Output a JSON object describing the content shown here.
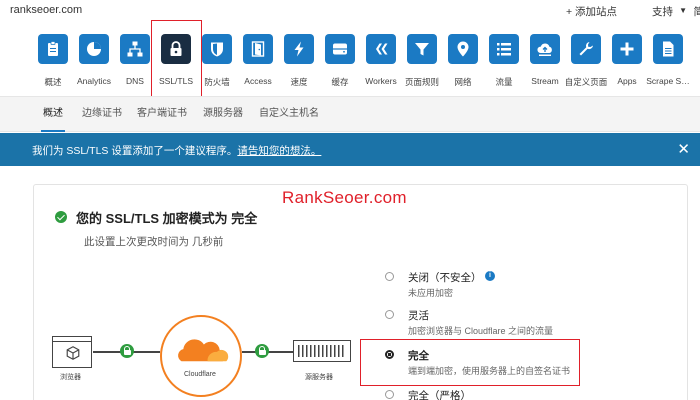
{
  "topbar": {
    "domain": "rankseoer.com",
    "add_site": "+ 添加站点",
    "support": "支持",
    "lang": "简"
  },
  "nav": {
    "items": [
      {
        "label": "概述",
        "icon": "clipboard-icon"
      },
      {
        "label": "Analytics",
        "icon": "pie-chart-icon"
      },
      {
        "label": "DNS",
        "icon": "network-icon"
      },
      {
        "label": "SSL/TLS",
        "icon": "lock-icon",
        "active": true
      },
      {
        "label": "防火墙",
        "icon": "shield-icon"
      },
      {
        "label": "Access",
        "icon": "door-icon"
      },
      {
        "label": "速度",
        "icon": "bolt-icon"
      },
      {
        "label": "缓存",
        "icon": "drive-icon"
      },
      {
        "label": "Workers",
        "icon": "workers-icon"
      },
      {
        "label": "页面规则",
        "icon": "filter-icon"
      },
      {
        "label": "网络",
        "icon": "location-pin-icon"
      },
      {
        "label": "流量",
        "icon": "list-icon"
      },
      {
        "label": "Stream",
        "icon": "cloud-upload-icon"
      },
      {
        "label": "自定义页面",
        "icon": "wrench-icon"
      },
      {
        "label": "Apps",
        "icon": "plus-icon"
      },
      {
        "label": "Scrape S…",
        "icon": "document-icon"
      }
    ]
  },
  "subtabs": [
    {
      "label": "概述",
      "active": true
    },
    {
      "label": "边缘证书"
    },
    {
      "label": "客户端证书"
    },
    {
      "label": "源服务器"
    },
    {
      "label": "自定义主机名"
    }
  ],
  "banner": {
    "text": "我们为 SSL/TLS 设置添加了一个建议程序。",
    "link": "请告知您的想法。",
    "close": "✕"
  },
  "card": {
    "watermark": "RankSeoer.com",
    "title": "您的 SSL/TLS 加密模式为 完全",
    "subtitle": "此设置上次更改时间为 几秒前",
    "diagram": {
      "browser_label": "浏览器",
      "cloudflare_label": "Cloudflare",
      "server_label": "源服务器"
    },
    "options": [
      {
        "title": "关闭（不安全）",
        "desc": "未应用加密",
        "selected": false,
        "info": true
      },
      {
        "title": "灵活",
        "desc": "加密浏览器与 Cloudflare 之间的流量",
        "selected": false
      },
      {
        "title": "完全",
        "desc": "端到端加密，使用服务器上的自签名证书",
        "selected": true
      },
      {
        "title": "完全（严格）",
        "desc": "",
        "selected": false
      }
    ]
  },
  "colors": {
    "tile": "#1b7ac4",
    "tile_active": "#1a2d42",
    "banner": "#1b73a8",
    "annotation_red": "#e0202a",
    "cloudflare_orange": "#f38020",
    "ok_green": "#2e9c3f"
  }
}
